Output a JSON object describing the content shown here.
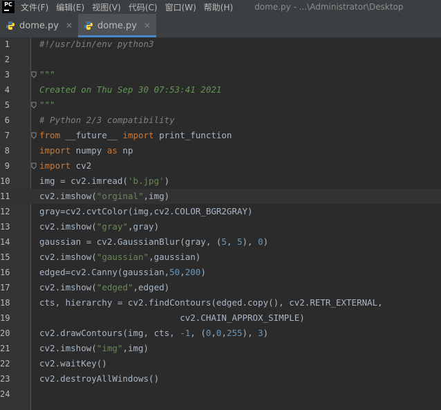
{
  "menubar": {
    "logo": "PC",
    "items": [
      "文件(F)",
      "编辑(E)",
      "视图(V)",
      "代码(C)",
      "窗口(W)",
      "帮助(H)"
    ],
    "window_title": "dome.py - ...\\Administrator\\Desktop"
  },
  "tabs": [
    {
      "label": "dome.py",
      "active": false
    },
    {
      "label": "dome.py",
      "active": true
    }
  ],
  "colors": {
    "keyword": "#cc7832",
    "string": "#6a8759",
    "number": "#6897bb",
    "comment": "#808080",
    "docstring": "#629755",
    "default": "#a9b7c6",
    "accent": "#4a88c7"
  },
  "editor": {
    "current_line": 11,
    "lines": [
      {
        "n": "1",
        "fold": false,
        "tokens": [
          {
            "t": "#!/usr/bin/env python3",
            "c": "cmt"
          }
        ]
      },
      {
        "n": "2",
        "fold": false,
        "tokens": []
      },
      {
        "n": "3",
        "fold": true,
        "tokens": [
          {
            "t": "\"\"\"",
            "c": "doc"
          }
        ]
      },
      {
        "n": "4",
        "fold": false,
        "tokens": [
          {
            "t": "Created on Thu Sep 30 07:53:41 2021",
            "c": "doc"
          }
        ]
      },
      {
        "n": "5",
        "fold": true,
        "tokens": [
          {
            "t": "\"\"\"",
            "c": "doc"
          }
        ]
      },
      {
        "n": "6",
        "fold": false,
        "tokens": [
          {
            "t": "# Python 2/3 compatibility",
            "c": "cmt"
          }
        ]
      },
      {
        "n": "7",
        "fold": true,
        "tokens": [
          {
            "t": "from",
            "c": "kw"
          },
          {
            "t": " __future__ ",
            "c": ""
          },
          {
            "t": "import",
            "c": "kw"
          },
          {
            "t": " print_function",
            "c": ""
          }
        ]
      },
      {
        "n": "8",
        "fold": false,
        "tokens": [
          {
            "t": "import",
            "c": "kw"
          },
          {
            "t": " numpy ",
            "c": ""
          },
          {
            "t": "as",
            "c": "kw"
          },
          {
            "t": " np",
            "c": ""
          }
        ]
      },
      {
        "n": "9",
        "fold": true,
        "tokens": [
          {
            "t": "import",
            "c": "kw"
          },
          {
            "t": " cv2",
            "c": ""
          }
        ]
      },
      {
        "n": "10",
        "fold": false,
        "tokens": [
          {
            "t": "img = cv2.imread(",
            "c": ""
          },
          {
            "t": "'b.jpg'",
            "c": "str"
          },
          {
            "t": ")",
            "c": ""
          }
        ]
      },
      {
        "n": "11",
        "fold": false,
        "tokens": [
          {
            "t": "cv2.imshow(",
            "c": ""
          },
          {
            "t": "\"orginal\"",
            "c": "str"
          },
          {
            "t": ",img)",
            "c": ""
          }
        ]
      },
      {
        "n": "12",
        "fold": false,
        "tokens": [
          {
            "t": "gray=cv2.cvtColor(img,cv2.COLOR_BGR2GRAY)",
            "c": ""
          }
        ]
      },
      {
        "n": "13",
        "fold": false,
        "tokens": [
          {
            "t": "cv2.imshow(",
            "c": ""
          },
          {
            "t": "\"gray\"",
            "c": "str"
          },
          {
            "t": ",gray)",
            "c": ""
          }
        ]
      },
      {
        "n": "14",
        "fold": false,
        "tokens": [
          {
            "t": "gaussian = cv2.GaussianBlur(gray, (",
            "c": ""
          },
          {
            "t": "5",
            "c": "num"
          },
          {
            "t": ", ",
            "c": ""
          },
          {
            "t": "5",
            "c": "num"
          },
          {
            "t": "), ",
            "c": ""
          },
          {
            "t": "0",
            "c": "num"
          },
          {
            "t": ")",
            "c": ""
          }
        ]
      },
      {
        "n": "15",
        "fold": false,
        "tokens": [
          {
            "t": "cv2.imshow(",
            "c": ""
          },
          {
            "t": "\"gaussian\"",
            "c": "str"
          },
          {
            "t": ",gaussian)",
            "c": ""
          }
        ]
      },
      {
        "n": "16",
        "fold": false,
        "tokens": [
          {
            "t": "edged=cv2.Canny(gaussian,",
            "c": ""
          },
          {
            "t": "50",
            "c": "num"
          },
          {
            "t": ",",
            "c": ""
          },
          {
            "t": "200",
            "c": "num"
          },
          {
            "t": ")",
            "c": ""
          }
        ]
      },
      {
        "n": "17",
        "fold": false,
        "tokens": [
          {
            "t": "cv2.imshow(",
            "c": ""
          },
          {
            "t": "\"edged\"",
            "c": "str"
          },
          {
            "t": ",edged)",
            "c": ""
          }
        ]
      },
      {
        "n": "18",
        "fold": false,
        "tokens": [
          {
            "t": "cts, hierarchy = cv2.findContours(edged.copy(), cv2.RETR_EXTERNAL,",
            "c": ""
          }
        ]
      },
      {
        "n": "19",
        "fold": false,
        "tokens": [
          {
            "t": "                           cv2.CHAIN_APPROX_SIMPLE)",
            "c": ""
          }
        ]
      },
      {
        "n": "20",
        "fold": false,
        "tokens": [
          {
            "t": "cv2.drawContours(img, cts, ",
            "c": ""
          },
          {
            "t": "-1",
            "c": "num"
          },
          {
            "t": ", (",
            "c": ""
          },
          {
            "t": "0",
            "c": "num"
          },
          {
            "t": ",",
            "c": ""
          },
          {
            "t": "0",
            "c": "num"
          },
          {
            "t": ",",
            "c": ""
          },
          {
            "t": "255",
            "c": "num"
          },
          {
            "t": "), ",
            "c": ""
          },
          {
            "t": "3",
            "c": "num"
          },
          {
            "t": ")",
            "c": ""
          }
        ]
      },
      {
        "n": "21",
        "fold": false,
        "tokens": [
          {
            "t": "cv2.imshow(",
            "c": ""
          },
          {
            "t": "\"img\"",
            "c": "str"
          },
          {
            "t": ",img)",
            "c": ""
          }
        ]
      },
      {
        "n": "22",
        "fold": false,
        "tokens": [
          {
            "t": "cv2.waitKey()",
            "c": ""
          }
        ]
      },
      {
        "n": "23",
        "fold": false,
        "tokens": [
          {
            "t": "cv2.destroyAllWindows()",
            "c": ""
          }
        ]
      },
      {
        "n": "24",
        "fold": false,
        "tokens": []
      }
    ]
  }
}
